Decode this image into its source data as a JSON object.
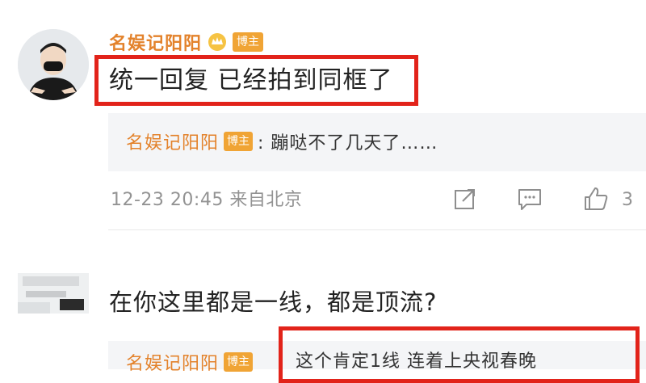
{
  "comment1": {
    "username": "名娱记阳阳",
    "badge": "博主",
    "text": "统一回复 已经拍到同框了",
    "reply": {
      "username": "名娱记阳阳",
      "badge": "博主",
      "text": ": 蹦哒不了几天了……"
    },
    "meta": {
      "timestamp": "12-23 20:45",
      "source": "来自北京",
      "like_count": "3"
    }
  },
  "comment2": {
    "text": "在你这里都是一线，都是顶流?",
    "reply": {
      "username": "名娱记阳阳",
      "badge": "博主",
      "text": "这个肯定1线 连着上央视春晚"
    }
  },
  "colors": {
    "username": "#e3822b",
    "badge": "#f0a435",
    "highlight": "#e2231a",
    "meta": "#939393"
  },
  "icons": [
    "share-icon",
    "comment-icon",
    "like-icon",
    "crown-icon"
  ]
}
